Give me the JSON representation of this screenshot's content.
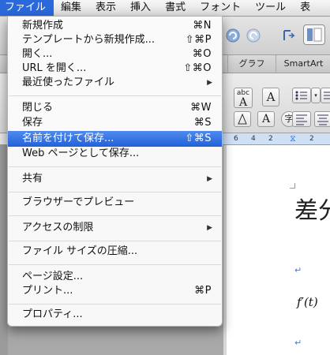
{
  "menubar": {
    "items": [
      "ファイル",
      "編集",
      "表示",
      "挿入",
      "書式",
      "フォント",
      "ツール",
      "表"
    ]
  },
  "tabs": [
    "グラフ",
    "SmartArt"
  ],
  "ribbon": {
    "abc_label": "abc",
    "a_label": "A",
    "char_label": "字"
  },
  "ruler": {
    "ticks": [
      "6",
      "4",
      "2",
      "2"
    ]
  },
  "document": {
    "title_fragment": "差分",
    "equation": "f′(t)",
    "para_mark": "↵"
  },
  "file_menu": {
    "items": [
      {
        "label": "新規作成",
        "shortcut": "⌘N"
      },
      {
        "label": "テンプレートから新規作成...",
        "shortcut": "⇧⌘P"
      },
      {
        "label": "開く...",
        "shortcut": "⌘O"
      },
      {
        "label": "URL を開く...",
        "shortcut": "⇧⌘O"
      },
      {
        "label": "最近使ったファイル",
        "submenu": true
      },
      {
        "label": "閉じる",
        "shortcut": "⌘W"
      },
      {
        "label": "保存",
        "shortcut": "⌘S"
      },
      {
        "label": "名前を付けて保存...",
        "shortcut": "⇧⌘S",
        "selected": true
      },
      {
        "label": "Web ページとして保存..."
      },
      {
        "label": "共有",
        "submenu": true
      },
      {
        "label": "ブラウザーでプレビュー"
      },
      {
        "label": "アクセスの制限",
        "submenu": true
      },
      {
        "label": "ファイル サイズの圧縮..."
      },
      {
        "label": "ページ設定..."
      },
      {
        "label": "プリント...",
        "shortcut": "⌘P"
      },
      {
        "label": "プロパティ..."
      }
    ]
  },
  "colors": {
    "selection": "#2a69dc",
    "menu_bg": "#fafafa"
  }
}
